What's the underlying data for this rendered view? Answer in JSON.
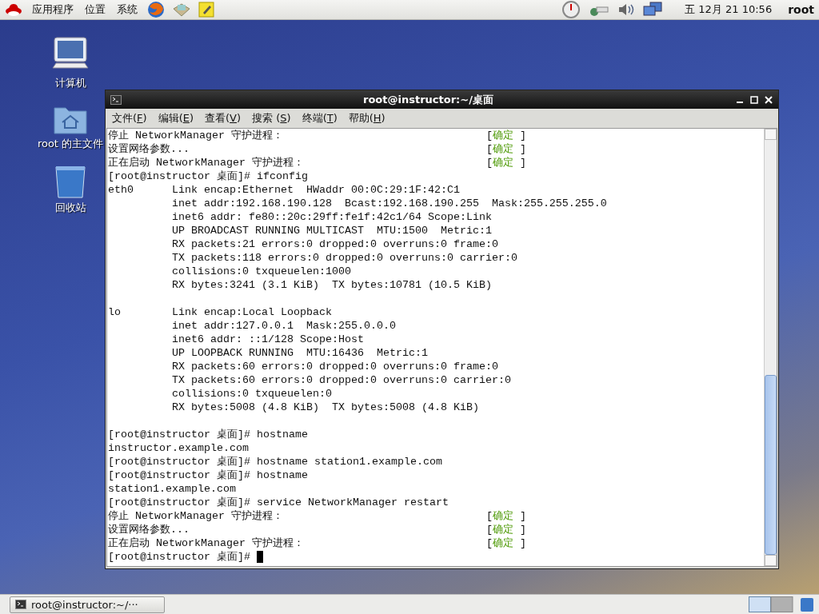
{
  "top_panel": {
    "menus": [
      "应用程序",
      "位置",
      "系统"
    ],
    "clock": "五 12月 21 10:56",
    "user": "root"
  },
  "desktop_icons": [
    {
      "kind": "computer",
      "label": "计算机"
    },
    {
      "kind": "home",
      "label": "root 的主文件"
    },
    {
      "kind": "trash",
      "label": "回收站"
    }
  ],
  "terminal": {
    "title": "root@instructor:~/桌面",
    "menu": [
      {
        "before": "文件(",
        "key": "F",
        "after": ")"
      },
      {
        "before": "编辑(",
        "key": "E",
        "after": ")"
      },
      {
        "before": "查看(",
        "key": "V",
        "after": ")"
      },
      {
        "before": "搜索 (",
        "key": "S",
        "after": ")"
      },
      {
        "before": "终端(",
        "key": "T",
        "after": ")"
      },
      {
        "before": "帮助(",
        "key": "H",
        "after": ")"
      }
    ],
    "lines": [
      {
        "text": "停止 NetworkManager 守护进程：",
        "open": "[",
        "status": "确定",
        "close": "]"
      },
      {
        "text": "设置网络参数...",
        "open": "[",
        "status": "确定",
        "close": "]"
      },
      {
        "text": "正在启动 NetworkManager 守护进程：",
        "open": "[",
        "status": "确定",
        "close": "]"
      },
      {
        "text": "[root@instructor 桌面]# ifconfig"
      },
      {
        "text": "eth0      Link encap:Ethernet  HWaddr 00:0C:29:1F:42:C1"
      },
      {
        "text": "          inet addr:192.168.190.128  Bcast:192.168.190.255  Mask:255.255.255.0"
      },
      {
        "text": "          inet6 addr: fe80::20c:29ff:fe1f:42c1/64 Scope:Link"
      },
      {
        "text": "          UP BROADCAST RUNNING MULTICAST  MTU:1500  Metric:1"
      },
      {
        "text": "          RX packets:21 errors:0 dropped:0 overruns:0 frame:0"
      },
      {
        "text": "          TX packets:118 errors:0 dropped:0 overruns:0 carrier:0"
      },
      {
        "text": "          collisions:0 txqueuelen:1000"
      },
      {
        "text": "          RX bytes:3241 (3.1 KiB)  TX bytes:10781 (10.5 KiB)"
      },
      {
        "text": "lo        Link encap:Local Loopback",
        "space_before": true
      },
      {
        "text": "          inet addr:127.0.0.1  Mask:255.0.0.0"
      },
      {
        "text": "          inet6 addr: ::1/128 Scope:Host"
      },
      {
        "text": "          UP LOOPBACK RUNNING  MTU:16436  Metric:1"
      },
      {
        "text": "          RX packets:60 errors:0 dropped:0 overruns:0 frame:0"
      },
      {
        "text": "          TX packets:60 errors:0 dropped:0 overruns:0 carrier:0"
      },
      {
        "text": "          collisions:0 txqueuelen:0"
      },
      {
        "text": "          RX bytes:5008 (4.8 KiB)  TX bytes:5008 (4.8 KiB)"
      },
      {
        "text": "[root@instructor 桌面]# hostname",
        "space_before": true
      },
      {
        "text": "instructor.example.com"
      },
      {
        "text": "[root@instructor 桌面]# hostname station1.example.com"
      },
      {
        "text": "[root@instructor 桌面]# hostname"
      },
      {
        "text": "station1.example.com"
      },
      {
        "text": "[root@instructor 桌面]# service NetworkManager restart"
      },
      {
        "text": "停止 NetworkManager 守护进程：",
        "open": "[",
        "status": "确定",
        "close": "]"
      },
      {
        "text": "设置网络参数...",
        "open": "[",
        "status": "确定",
        "close": "]"
      },
      {
        "text": "正在启动 NetworkManager 守护进程：",
        "open": "[",
        "status": "确定",
        "close": "]"
      },
      {
        "text": "[root@instructor 桌面]# ",
        "cursor": true
      }
    ]
  },
  "taskbar": {
    "tasks": [
      {
        "label": "root@instructor:~/···",
        "selected": false
      }
    ]
  }
}
